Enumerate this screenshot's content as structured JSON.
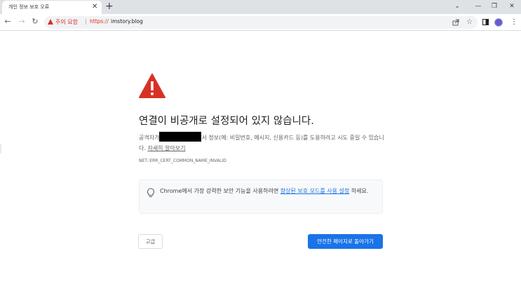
{
  "tab": {
    "title": "개인 정보 보호 오류",
    "close": "✕",
    "new_tab": "+"
  },
  "window_controls": {
    "menu": "⌄",
    "minimize": "—",
    "restore": "❐",
    "close": "✕"
  },
  "nav": {
    "back": "←",
    "forward": "→",
    "reload": "↻"
  },
  "omnibox": {
    "security_label": "주의 요함",
    "separator": "|",
    "url_scheme": "https://",
    "url_host": "imstory.blog"
  },
  "colors": {
    "danger": "#d93025",
    "accent": "#1a73e8",
    "text": "#202124",
    "muted": "#5f6368"
  },
  "error": {
    "title": "연결이 비공개로 설정되어 있지 않습니다.",
    "desc_before": "공격자가",
    "desc_after": "서 정보(예: 비밀번호, 메시지, 신용카드 등)를 도용하려고 시도 중일 수 있습니다.",
    "learn_more": "자세히 알아보기",
    "code": "NET::ERR_CERT_COMMON_NAME_INVALID"
  },
  "info": {
    "text_before": "Chrome에서 가장 강력한 보안 기능을 사용하려면",
    "link": "향상된 보호 모드를 사용 설정",
    "text_after": "하세요."
  },
  "buttons": {
    "advanced": "고급",
    "back_to_safety": "안전한 페이지로 돌아가기"
  }
}
